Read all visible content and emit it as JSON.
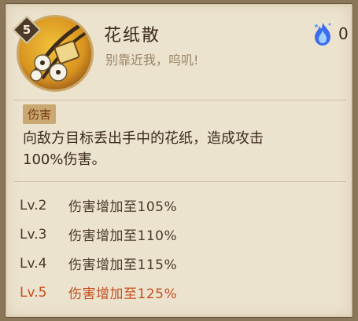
{
  "skill": {
    "name": "花纸散",
    "quote": "别靠近我，呜叽!",
    "level_badge": "5",
    "cost": "0",
    "cost_icon": "blue-soul-fire-icon"
  },
  "effect": {
    "tag": "伤害",
    "description_line1": "向敌方目标丢出手中的花纸，造成攻击",
    "description_line2": "100%伤害。"
  },
  "levels": [
    {
      "lv": "Lv.2",
      "text": "伤害增加至105%",
      "active": false
    },
    {
      "lv": "Lv.3",
      "text": "伤害增加至110%",
      "active": false
    },
    {
      "lv": "Lv.4",
      "text": "伤害增加至115%",
      "active": false
    },
    {
      "lv": "Lv.5",
      "text": "伤害增加至125%",
      "active": true
    }
  ],
  "colors": {
    "panel_bg": "#ece3cf",
    "active_level": "#c54d1e",
    "tag_bg": "#c9a871"
  }
}
